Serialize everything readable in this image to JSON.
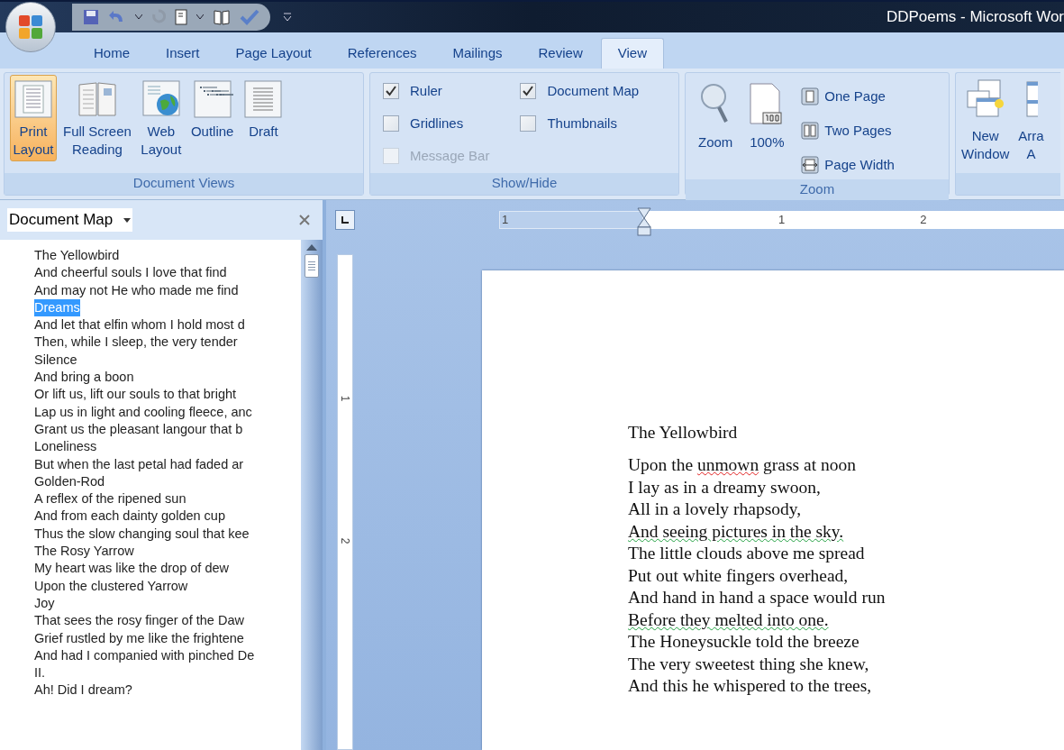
{
  "window": {
    "title": "DDPoems - Microsoft Wor"
  },
  "tabs": [
    {
      "label": "Home",
      "selected": false
    },
    {
      "label": "Insert",
      "selected": false
    },
    {
      "label": "Page Layout",
      "selected": false
    },
    {
      "label": "References",
      "selected": false
    },
    {
      "label": "Mailings",
      "selected": false
    },
    {
      "label": "Review",
      "selected": false
    },
    {
      "label": "View",
      "selected": true
    }
  ],
  "ribbon": {
    "document_views": {
      "label": "Document Views",
      "buttons": [
        {
          "kind": "print",
          "lines": [
            "Print",
            "Layout"
          ],
          "selected": true
        },
        {
          "kind": "reading",
          "lines": [
            "Full Screen",
            "Reading"
          ],
          "selected": false
        },
        {
          "kind": "web",
          "lines": [
            "Web",
            "Layout"
          ],
          "selected": false
        },
        {
          "kind": "outline",
          "lines": [
            "Outline"
          ],
          "selected": false
        },
        {
          "kind": "draft",
          "lines": [
            "Draft"
          ],
          "selected": false
        }
      ]
    },
    "show_hide": {
      "label": "Show/Hide",
      "columns": [
        [
          {
            "label": "Ruler",
            "checked": true,
            "disabled": false
          },
          {
            "label": "Gridlines",
            "checked": false,
            "disabled": false
          },
          {
            "label": "Message Bar",
            "checked": false,
            "disabled": true
          }
        ],
        [
          {
            "label": "Document Map",
            "checked": true,
            "disabled": false
          },
          {
            "label": "Thumbnails",
            "checked": false,
            "disabled": false
          }
        ]
      ]
    },
    "zoom": {
      "label": "Zoom",
      "large": [
        {
          "kind": "zoom",
          "label": "Zoom"
        },
        {
          "kind": "hundred",
          "label": "100%"
        }
      ],
      "small": [
        {
          "kind": "one",
          "label": "One Page"
        },
        {
          "kind": "two",
          "label": "Two Pages"
        },
        {
          "kind": "width",
          "label": "Page Width"
        }
      ]
    },
    "window_group": {
      "buttons": [
        {
          "kind": "new",
          "lines": [
            "New",
            "Window"
          ]
        },
        {
          "kind": "arrange",
          "lines": [
            "Arra",
            "A"
          ]
        }
      ]
    }
  },
  "document_map": {
    "title": "Document Map",
    "items": [
      {
        "text": "The Yellowbird",
        "selected": false
      },
      {
        "text": "And cheerful souls I love that find",
        "selected": false
      },
      {
        "text": "And may not He who made me find",
        "selected": false
      },
      {
        "text": "Dreams",
        "selected": true
      },
      {
        "text": "And let that elfin whom I hold most d",
        "selected": false
      },
      {
        "text": "Then, while I sleep, the very tender",
        "selected": false
      },
      {
        "text": "Silence",
        "selected": false
      },
      {
        "text": "And bring a boon",
        "selected": false
      },
      {
        "text": "Or lift us, lift our souls to that bright",
        "selected": false
      },
      {
        "text": "Lap us in light and cooling fleece, anc",
        "selected": false
      },
      {
        "text": "Grant us the pleasant langour that b",
        "selected": false
      },
      {
        "text": "Loneliness",
        "selected": false
      },
      {
        "text": "But when the last petal had faded ar",
        "selected": false
      },
      {
        "text": "Golden-Rod",
        "selected": false
      },
      {
        "text": "A reflex of the ripened sun",
        "selected": false
      },
      {
        "text": "And from each dainty golden cup",
        "selected": false
      },
      {
        "text": "Thus the slow changing soul that kee",
        "selected": false
      },
      {
        "text": "The Rosy Yarrow",
        "selected": false
      },
      {
        "text": "My heart was like the drop of dew",
        "selected": false
      },
      {
        "text": "Upon the clustered Yarrow",
        "selected": false
      },
      {
        "text": "Joy",
        "selected": false
      },
      {
        "text": "That sees the rosy finger of the Daw",
        "selected": false
      },
      {
        "text": "Grief rustled by me like the frightene",
        "selected": false
      },
      {
        "text": "And had I companied with pinched De",
        "selected": false
      },
      {
        "text": "II.",
        "selected": false
      },
      {
        "text": "Ah! Did I dream?",
        "selected": false
      }
    ]
  },
  "ruler": {
    "horizontal_labels": [
      "1",
      "1",
      "2"
    ],
    "vertical_labels": [
      "1",
      "2"
    ]
  },
  "document": {
    "title": "The Yellowbird",
    "lines": [
      {
        "segments": [
          {
            "text": "Upon the ",
            "spelling_error": false,
            "grammar_error": false
          },
          {
            "text": "unmown",
            "spelling_error": true,
            "grammar_error": false
          },
          {
            "text": " grass at noon",
            "spelling_error": false,
            "grammar_error": false
          }
        ]
      },
      {
        "segments": [
          {
            "text": "I lay as in a dreamy swoon,",
            "spelling_error": false,
            "grammar_error": false
          }
        ]
      },
      {
        "segments": [
          {
            "text": "All in a lovely rhapsody,",
            "spelling_error": false,
            "grammar_error": false
          }
        ]
      },
      {
        "segments": [
          {
            "text": "And seeing pictures in the sky.",
            "spelling_error": false,
            "grammar_error": true
          }
        ]
      },
      {
        "segments": [
          {
            "text": "The little clouds above me spread",
            "spelling_error": false,
            "grammar_error": false
          }
        ]
      },
      {
        "segments": [
          {
            "text": "Put out white fingers overhead,",
            "spelling_error": false,
            "grammar_error": false
          }
        ]
      },
      {
        "segments": [
          {
            "text": "And hand in hand a space would run",
            "spelling_error": false,
            "grammar_error": false
          }
        ]
      },
      {
        "segments": [
          {
            "text": "Before they melted into one.",
            "spelling_error": false,
            "grammar_error": true
          }
        ]
      },
      {
        "segments": [
          {
            "text": "The Honeysuckle told the breeze",
            "spelling_error": false,
            "grammar_error": false
          }
        ]
      },
      {
        "segments": [
          {
            "text": "The very sweetest thing she knew,",
            "spelling_error": false,
            "grammar_error": false
          }
        ]
      },
      {
        "segments": [
          {
            "text": "And this he whispered to the trees,",
            "spelling_error": false,
            "grammar_error": false
          }
        ]
      }
    ]
  }
}
